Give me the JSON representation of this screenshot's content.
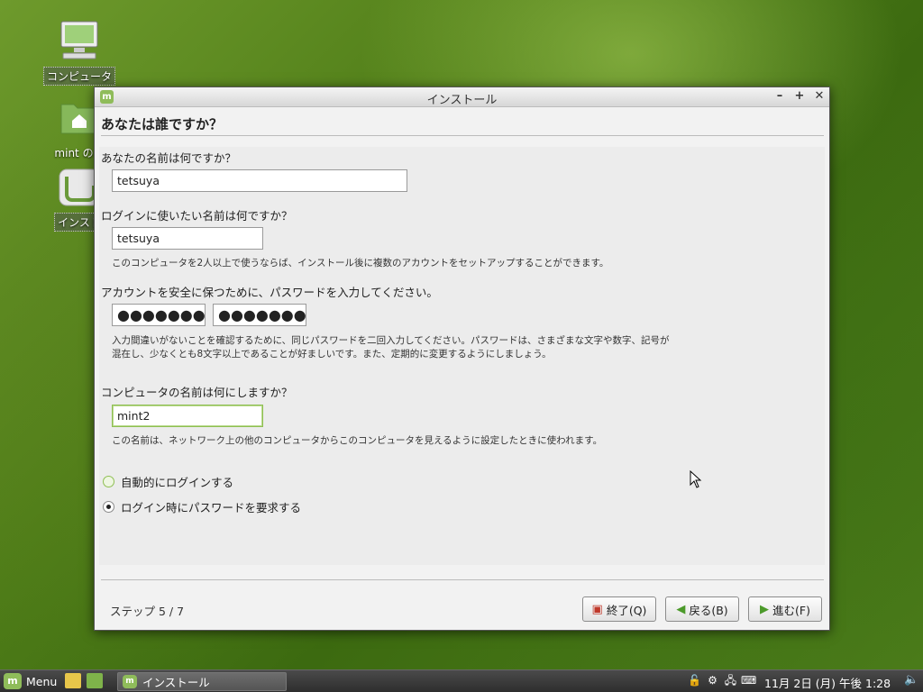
{
  "desktop": {
    "icons": [
      {
        "label": "コンピュータ"
      },
      {
        "label": "mint のホ"
      },
      {
        "label": "インスト"
      }
    ]
  },
  "window": {
    "title": "インストール",
    "heading": "あなたは誰ですか？",
    "name_question": "あなたの名前は何ですか？",
    "name_value": "tetsuya",
    "login_question": "ログインに使いたい名前は何ですか？",
    "login_value": "tetsuya",
    "login_note": "このコンピュータを2人以上で使うならば、インストール後に複数のアカウントをセットアップすることができます。",
    "password_question": "アカウントを安全に保つために、パスワードを入力してください。",
    "password_value": "●●●●●●●●",
    "password_confirm_value": "●●●●●●●●",
    "password_note_1": "入力間違いがないことを確認するために、同じパスワードを二回入力してください。パスワードは、さまざまな文字や数字、記号が",
    "password_note_2": "混在し、少なくとも8文字以上であることが好ましいです。また、定期的に変更するようにしましょう。",
    "hostname_question": "コンピュータの名前は何にしますか？",
    "hostname_value": "mint2",
    "hostname_note": "この名前は、ネットワーク上の他のコンピュータからこのコンピュータを見えるように設定したときに使われます。",
    "radio_auto_login": "自動的にログインする",
    "radio_require_password": "ログイン時にパスワードを要求する",
    "selected_option": "ログイン時にパスワードを要求する",
    "step": "ステップ 5 / 7",
    "btn_quit": "終了(Q)",
    "btn_back": "戻る(B)",
    "btn_forward": "進む(F)"
  },
  "taskbar": {
    "menu_label": "Menu",
    "task_label": "インストール",
    "clock": "11月 2日 (月) 午後 1:28"
  },
  "colors": {
    "accent": "#8fbf53",
    "button_quit_icon": "#c0392b",
    "arrow_green": "#4c9a2a"
  }
}
